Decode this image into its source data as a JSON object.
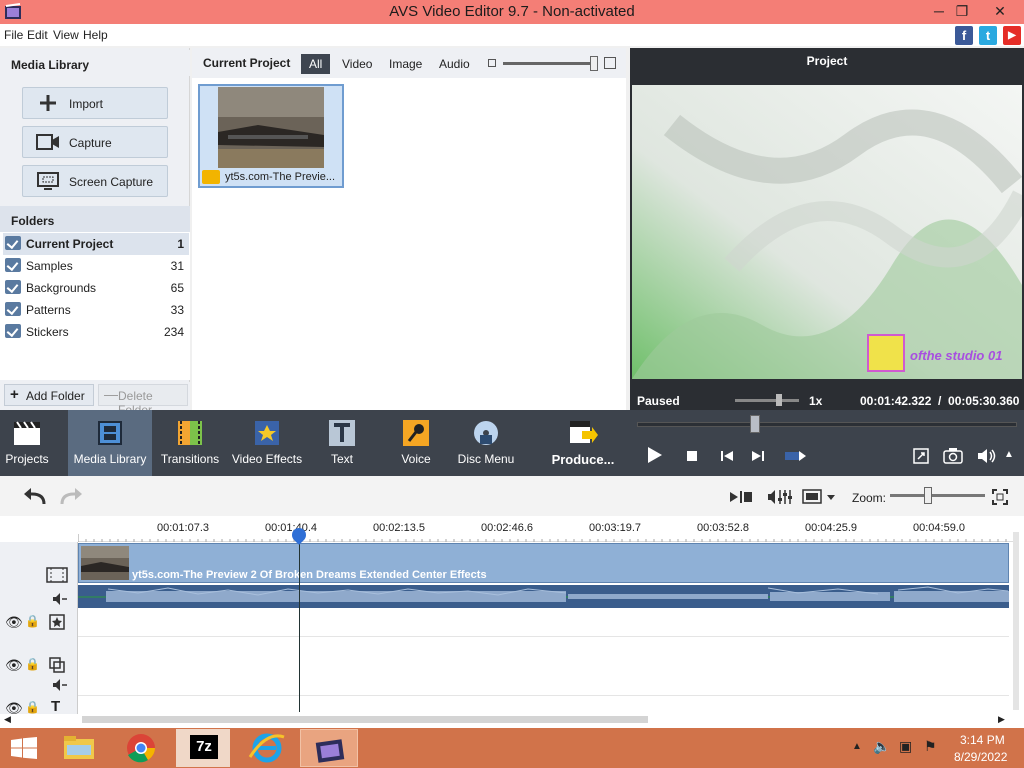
{
  "window": {
    "title": "AVS Video Editor 9.7 - Non-activated"
  },
  "menu": [
    "File",
    "Edit",
    "View",
    "Help"
  ],
  "social": {
    "facebook": "f",
    "twitter": "t",
    "youtube": "▶"
  },
  "media_library": {
    "title": "Media Library",
    "buttons": [
      "Import",
      "Capture",
      "Screen Capture"
    ]
  },
  "folders": {
    "title": "Folders",
    "items": [
      {
        "name": "Current Project",
        "count": "1"
      },
      {
        "name": "Samples",
        "count": "31"
      },
      {
        "name": "Backgrounds",
        "count": "65"
      },
      {
        "name": "Patterns",
        "count": "33"
      },
      {
        "name": "Stickers",
        "count": "234"
      }
    ],
    "add_label": "Add Folder",
    "delete_label": "Delete Folder"
  },
  "media": {
    "title": "Current Project",
    "filters": [
      "All",
      "Video",
      "Image",
      "Audio"
    ],
    "clip_name": "yt5s.com-The Previe..."
  },
  "preview": {
    "title": "Project",
    "status": "Paused",
    "speed": "1x",
    "time": "00:01:42.322  /  00:05:30.360",
    "overlay_text": "ofthe studio 01"
  },
  "toolbar": {
    "items": [
      "Projects",
      "Media Library",
      "Transitions",
      "Video Effects",
      "Text",
      "Voice",
      "Disc Menu"
    ],
    "produce_label": "Produce..."
  },
  "timeline": {
    "zoom_label": "Zoom:",
    "ticks": [
      "00:01:07.3",
      "00:01:40.4",
      "00:02:13.5",
      "00:02:46.6",
      "00:03:19.7",
      "00:03:52.8",
      "00:04:25.9",
      "00:04:59.0"
    ],
    "clip_title": "yt5s.com-The Preview 2 Of Broken Dreams Extended Center Effects"
  },
  "taskbar": {
    "time": "3:14 PM",
    "date": "8/29/2022"
  },
  "colors": {
    "titlebar": "#f47e76",
    "accent": "#6f9cd0",
    "toolbar": "#3d434c",
    "taskbar": "#d1734a"
  }
}
